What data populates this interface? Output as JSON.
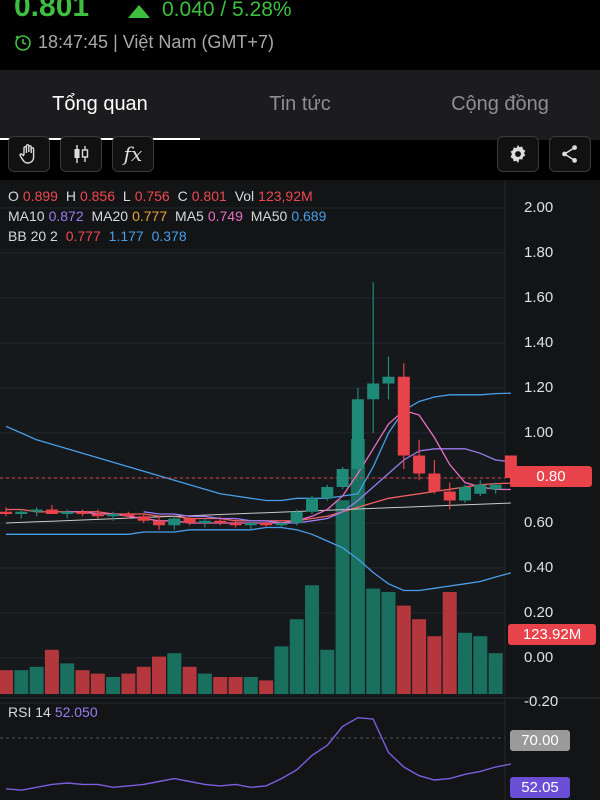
{
  "header": {
    "price": "0.801",
    "change": "0.040 / 5.28%",
    "time": "18:47:45 | Việt Nam (GMT+7)"
  },
  "tabs": [
    {
      "label": "Tổng quan",
      "active": true
    },
    {
      "label": "Tin tức",
      "active": false
    },
    {
      "label": "Cộng đồng",
      "active": false
    }
  ],
  "toolbar": {
    "icons": [
      "hand-icon",
      "candlestick-icon",
      "function-icon",
      "gear-icon",
      "share-icon"
    ],
    "fx_label": "fx"
  },
  "legend": {
    "ohlc": [
      {
        "label": "O",
        "value": "0.899"
      },
      {
        "label": "H",
        "value": "0.856"
      },
      {
        "label": "L",
        "value": "0.756"
      },
      {
        "label": "C",
        "value": "0.801"
      },
      {
        "label": "Vol",
        "value": "123,92M"
      }
    ],
    "ma": [
      {
        "label": "MA10",
        "value": "0.872"
      },
      {
        "label": "MA20",
        "value": "0.777"
      },
      {
        "label": "MA5",
        "value": "0.749"
      },
      {
        "label": "MA50",
        "value": "0.689"
      }
    ],
    "bb": {
      "label": "BB 20 2",
      "values": [
        "0.777",
        "1.177",
        "0.378"
      ]
    },
    "rsi": {
      "label": "RSI 14",
      "value": "52.050"
    }
  },
  "axis": {
    "labels": [
      "2.00",
      "1.80",
      "1.60",
      "1.40",
      "1.20",
      "1.00",
      "0.80",
      "0.60",
      "0.40",
      "0.20",
      "0.00",
      "-0.20"
    ],
    "price_tag": "0.80",
    "volume_tag": "123.92M",
    "rsi_level_tag": "70.00",
    "rsi_value_tag": "52.05"
  },
  "colors": {
    "up": "#1f8a77",
    "down": "#e8424a",
    "volume_up": "#19705f",
    "volume_down": "#b4373e",
    "ma_pink": "#e96fc4",
    "ma_purple": "#9b7cf0",
    "bb_blue": "#4a9ee8",
    "rsi_line": "#7c5ee0"
  },
  "chart_data": {
    "type": "candlestick",
    "ylim": [
      -0.2,
      2.05
    ],
    "candles": [
      {
        "o": 0.65,
        "h": 0.67,
        "l": 0.63,
        "c": 0.64
      },
      {
        "o": 0.64,
        "h": 0.66,
        "l": 0.62,
        "c": 0.65
      },
      {
        "o": 0.65,
        "h": 0.67,
        "l": 0.63,
        "c": 0.66
      },
      {
        "o": 0.66,
        "h": 0.68,
        "l": 0.64,
        "c": 0.64
      },
      {
        "o": 0.64,
        "h": 0.66,
        "l": 0.62,
        "c": 0.65
      },
      {
        "o": 0.65,
        "h": 0.66,
        "l": 0.63,
        "c": 0.64
      },
      {
        "o": 0.64,
        "h": 0.66,
        "l": 0.62,
        "c": 0.63
      },
      {
        "o": 0.63,
        "h": 0.65,
        "l": 0.61,
        "c": 0.64
      },
      {
        "o": 0.64,
        "h": 0.65,
        "l": 0.62,
        "c": 0.63
      },
      {
        "o": 0.63,
        "h": 0.64,
        "l": 0.6,
        "c": 0.61
      },
      {
        "o": 0.61,
        "h": 0.63,
        "l": 0.57,
        "c": 0.59
      },
      {
        "o": 0.59,
        "h": 0.63,
        "l": 0.57,
        "c": 0.62
      },
      {
        "o": 0.62,
        "h": 0.63,
        "l": 0.59,
        "c": 0.6
      },
      {
        "o": 0.6,
        "h": 0.62,
        "l": 0.58,
        "c": 0.61
      },
      {
        "o": 0.61,
        "h": 0.63,
        "l": 0.59,
        "c": 0.6
      },
      {
        "o": 0.6,
        "h": 0.62,
        "l": 0.58,
        "c": 0.59
      },
      {
        "o": 0.59,
        "h": 0.61,
        "l": 0.57,
        "c": 0.6
      },
      {
        "o": 0.6,
        "h": 0.61,
        "l": 0.58,
        "c": 0.59
      },
      {
        "o": 0.59,
        "h": 0.6,
        "l": 0.58,
        "c": 0.6
      },
      {
        "o": 0.6,
        "h": 0.66,
        "l": 0.59,
        "c": 0.65
      },
      {
        "o": 0.65,
        "h": 0.72,
        "l": 0.64,
        "c": 0.71
      },
      {
        "o": 0.71,
        "h": 0.77,
        "l": 0.7,
        "c": 0.76
      },
      {
        "o": 0.76,
        "h": 0.85,
        "l": 0.75,
        "c": 0.84
      },
      {
        "o": 0.84,
        "h": 1.2,
        "l": 0.83,
        "c": 1.15
      },
      {
        "o": 1.15,
        "h": 1.67,
        "l": 1.0,
        "c": 1.22
      },
      {
        "o": 1.22,
        "h": 1.34,
        "l": 1.15,
        "c": 1.25
      },
      {
        "o": 1.25,
        "h": 1.31,
        "l": 0.84,
        "c": 0.9
      },
      {
        "o": 0.9,
        "h": 0.97,
        "l": 0.79,
        "c": 0.82
      },
      {
        "o": 0.82,
        "h": 0.88,
        "l": 0.73,
        "c": 0.74
      },
      {
        "o": 0.74,
        "h": 0.78,
        "l": 0.66,
        "c": 0.7
      },
      {
        "o": 0.7,
        "h": 0.77,
        "l": 0.69,
        "c": 0.76
      },
      {
        "o": 0.73,
        "h": 0.79,
        "l": 0.72,
        "c": 0.77
      },
      {
        "o": 0.75,
        "h": 0.78,
        "l": 0.73,
        "c": 0.77
      },
      {
        "o": 0.9,
        "h": 0.9,
        "l": 0.76,
        "c": 0.8
      }
    ],
    "volume_scaled": [
      0.07,
      0.07,
      0.08,
      0.13,
      0.09,
      0.07,
      0.06,
      0.05,
      0.06,
      0.08,
      0.11,
      0.12,
      0.08,
      0.06,
      0.05,
      0.05,
      0.05,
      0.04,
      0.14,
      0.22,
      0.32,
      0.13,
      0.57,
      0.75,
      0.31,
      0.3,
      0.26,
      0.22,
      0.17,
      0.3,
      0.18,
      0.17,
      0.12
    ],
    "rsi": [
      35,
      34,
      36,
      38,
      39,
      38,
      38,
      36,
      37,
      38,
      40,
      42,
      40,
      38,
      37,
      38,
      36,
      37,
      42,
      48,
      58,
      65,
      78,
      84,
      83,
      60,
      50,
      44,
      41,
      42,
      45,
      47,
      50,
      52
    ]
  }
}
